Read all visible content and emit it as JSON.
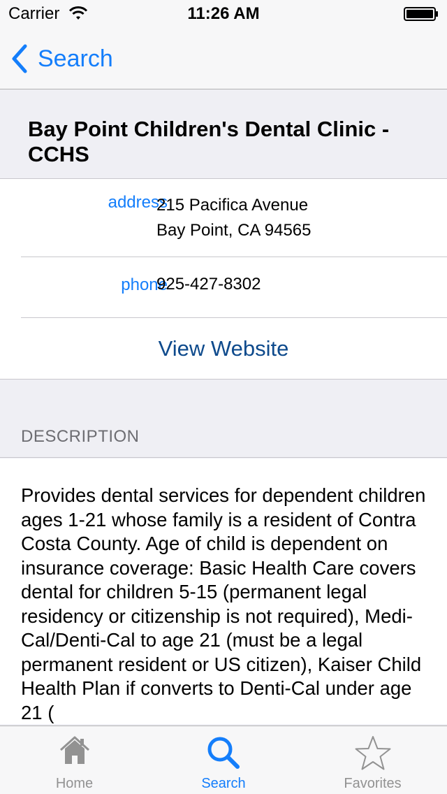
{
  "status_bar": {
    "carrier": "Carrier",
    "time": "11:26 AM",
    "wifi_icon": "wifi-icon",
    "battery_icon": "battery-icon"
  },
  "nav": {
    "back_label": "Search",
    "back_icon": "chevron-left-icon",
    "accent_color": "#147efb"
  },
  "clinic": {
    "title": "Bay Point Children's Dental Clinic - CCHS"
  },
  "info": {
    "address_label": "address",
    "address_line1": "215 Pacifica Avenue",
    "address_line2": "Bay Point, CA 94565",
    "phone_label": "phone",
    "phone_value": "925-427-8302",
    "website_label": "View Website"
  },
  "description": {
    "header": "DESCRIPTION",
    "text": "Provides dental services for dependent children ages 1-21 whose family is a resident of Contra Costa County. Age of child is dependent on insurance coverage: Basic Health Care covers dental for children 5-15 (permanent legal residency or citizenship is not required), Medi-Cal/Denti-Cal to age 21 (must be a legal permanent resident or US citizen), Kaiser Child Health Plan if converts to Denti-Cal under age 21 ("
  },
  "tabs": [
    {
      "label": "Home",
      "icon": "home-icon",
      "active": false
    },
    {
      "label": "Search",
      "icon": "search-icon",
      "active": true
    },
    {
      "label": "Favorites",
      "icon": "star-icon",
      "active": false
    }
  ]
}
